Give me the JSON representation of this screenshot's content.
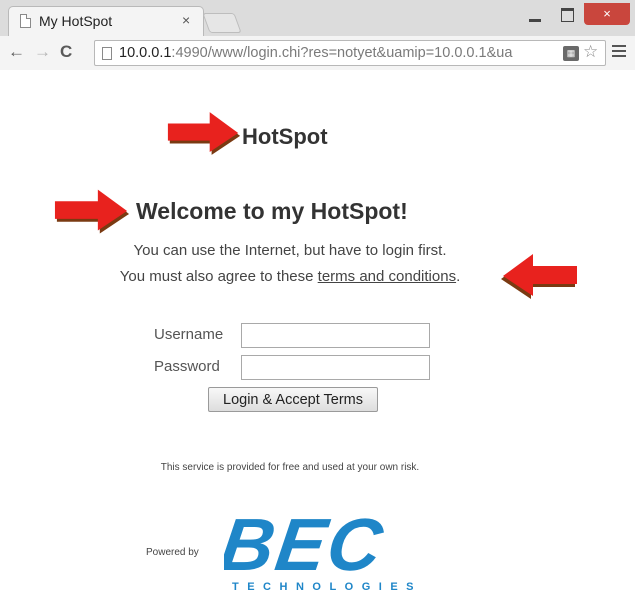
{
  "browser": {
    "tab_title": "My HotSpot",
    "tab_close": "×",
    "url_host": "10.0.0.1",
    "url_rest": ":4990/www/login.chi?res=notyet&uamip=10.0.0.1&ua",
    "window_close": "×"
  },
  "page": {
    "title": "HotSpot",
    "welcome": "Welcome to my HotSpot!",
    "line1": "You can use the Internet, but have to login first.",
    "line2_prefix": "You must also agree to these ",
    "terms_link": "terms and conditions",
    "line2_suffix": "."
  },
  "form": {
    "username_label": "Username",
    "password_label": "Password",
    "username_value": "",
    "password_value": "",
    "submit_label": "Login & Accept Terms"
  },
  "footer": {
    "disclaimer": "This service is provided for free and used at your own risk.",
    "powered_by": "Powered by",
    "brand": "BEC",
    "brand_tagline": "TECHNOLOGIES"
  },
  "colors": {
    "arrow_red": "#e8221e",
    "arrow_shadow": "#7a3a12",
    "brand_blue": "#1f86c8"
  }
}
